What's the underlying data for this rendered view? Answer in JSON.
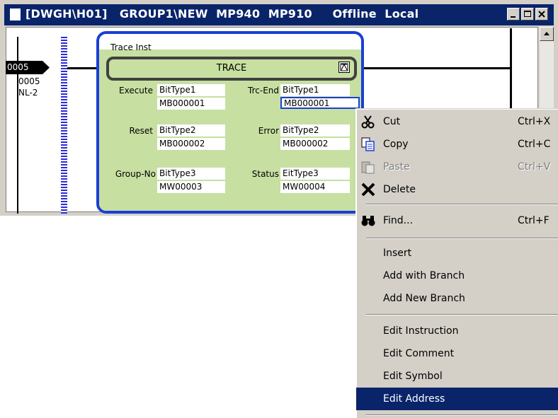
{
  "window": {
    "title": "[DWGH\\H01]   GROUP1\\NEW  MP940  MP910     Offline  Local",
    "buttons": {
      "minimize": "_",
      "restore": "□",
      "close": "×"
    }
  },
  "ladder": {
    "step_tag": "0005",
    "step_number": "0005",
    "nest_level": "NL-2"
  },
  "block": {
    "instance_title": "Trace Inst",
    "name": "TRACE",
    "left_params": [
      {
        "label": "Execute",
        "type": "BitType1",
        "address": "MB000001"
      },
      {
        "label": "Reset",
        "type": "BitType2",
        "address": "MB000002"
      },
      {
        "label": "Group-No",
        "type": "BitType3",
        "address": "MW00003"
      }
    ],
    "right_params": [
      {
        "label": "Trc-End",
        "type": "BitType1",
        "address": "MB000001"
      },
      {
        "label": "Error",
        "type": "BitType2",
        "address": "MB000002"
      },
      {
        "label": "Status",
        "type": "EitType3",
        "address": "MW00004"
      }
    ]
  },
  "context_menu": {
    "items": [
      {
        "label": "Cut",
        "shortcut": "Ctrl+X",
        "icon": "scissors-icon",
        "enabled": true
      },
      {
        "label": "Copy",
        "shortcut": "Ctrl+C",
        "icon": "copy-icon",
        "enabled": true
      },
      {
        "label": "Paste",
        "shortcut": "Ctrl+V",
        "icon": "paste-icon",
        "enabled": false
      },
      {
        "label": "Delete",
        "shortcut": "",
        "icon": "x-delete-icon",
        "enabled": true
      },
      {
        "label": "Find...",
        "shortcut": "Ctrl+F",
        "icon": "binoculars-icon",
        "enabled": true
      },
      {
        "label": "Insert",
        "shortcut": "",
        "enabled": true
      },
      {
        "label": "Add with Branch",
        "shortcut": "",
        "enabled": true
      },
      {
        "label": "Add New Branch",
        "shortcut": "",
        "enabled": true
      },
      {
        "label": "Edit Instruction",
        "shortcut": "",
        "enabled": true
      },
      {
        "label": "Edit Comment",
        "shortcut": "",
        "enabled": true
      },
      {
        "label": "Edit Symbol",
        "shortcut": "",
        "enabled": true
      },
      {
        "label": "Edit Address",
        "shortcut": "",
        "enabled": true,
        "selected": true
      }
    ]
  },
  "colors": {
    "title_bar": "#0a246a",
    "menu_highlight": "#0a246a",
    "block_border": "#1a3fd6",
    "block_fill": "#c7dfa1",
    "chrome": "#d4d0c8"
  }
}
